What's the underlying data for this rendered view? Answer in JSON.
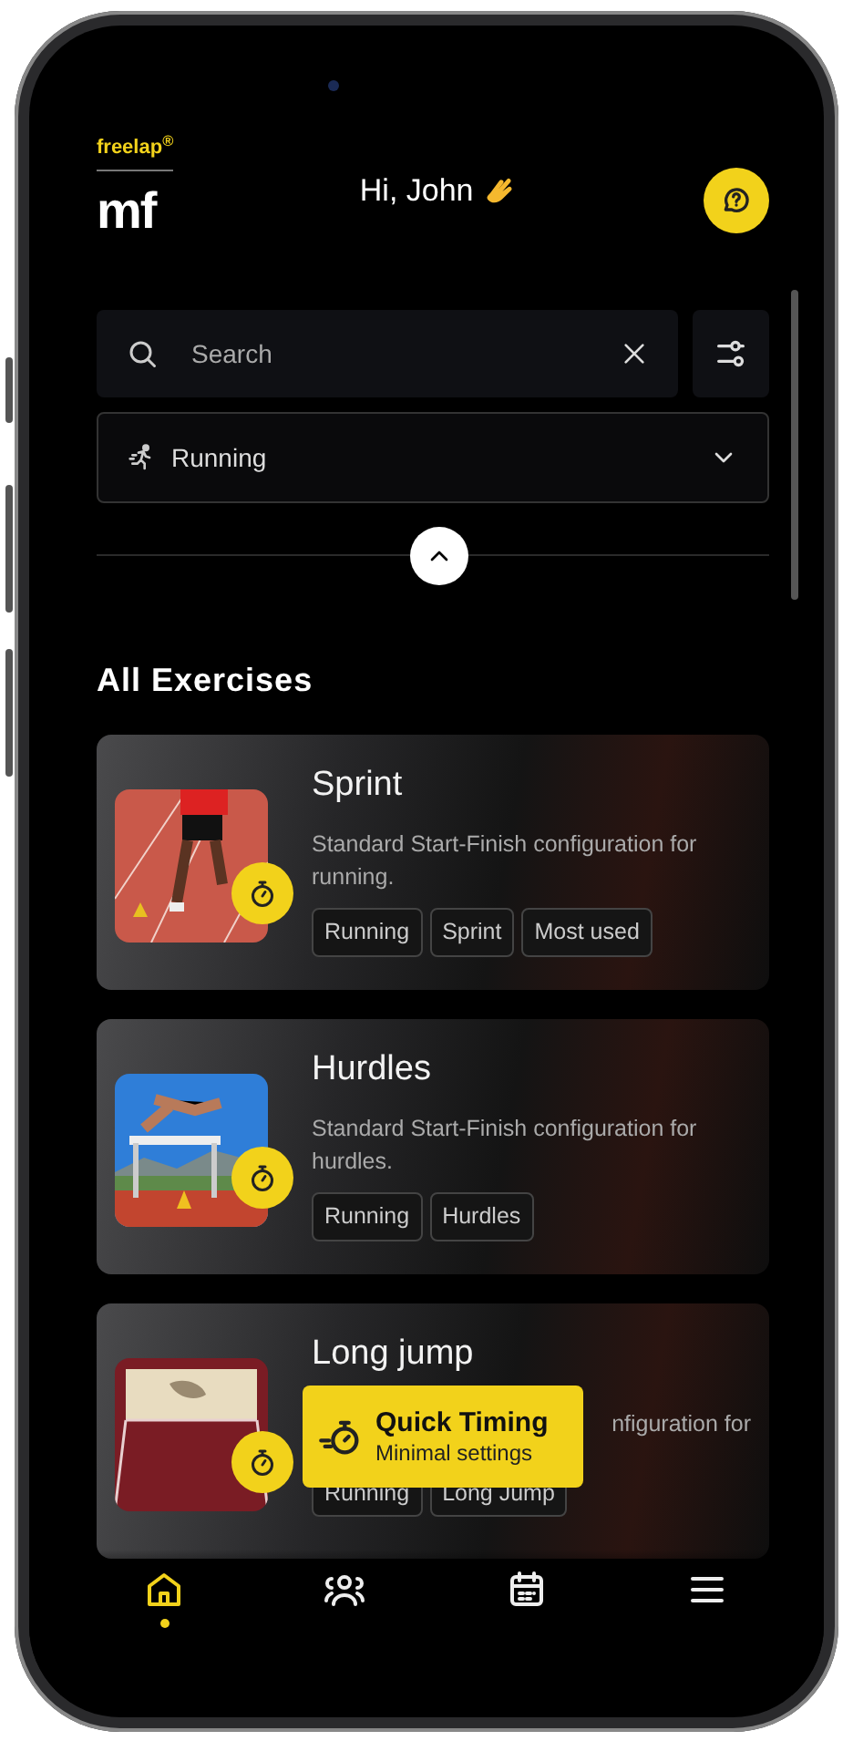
{
  "header": {
    "brand": "freelap$^{®}$",
    "mark": "m**f**",
    "greeting": "Hi, John"
  },
  "search": {
    "placeholder": "Search"
  },
  "sport_select": {
    "value": "Running",
    "expanded": false
  },
  "section_title": "All Exercises",
  "exercises": [
    {
      "title": "Sprint",
      "description": "Standard Start-Finish configuration for running.",
      "tags": [
        "Running",
        "Sprint",
        "Most used"
      ]
    },
    {
      "title": "Hurdles",
      "description": "Standard Start-Finish configuration for hurdles.",
      "tags": [
        "Running",
        "Hurdles"
      ]
    },
    {
      "title": "Long jump",
      "description": "nfiguration for",
      "tags": [
        "Running",
        "Long Jump"
      ]
    }
  ],
  "quick_timing": {
    "title": "Quick Timing",
    "subtitle": "Minimal settings"
  },
  "nav": [
    {
      "kind": "home",
      "selected": true
    },
    {
      "kind": "people",
      "selected": false
    },
    {
      "kind": "calendar",
      "selected": false
    },
    {
      "kind": "menu",
      "selected": false
    }
  ]
}
